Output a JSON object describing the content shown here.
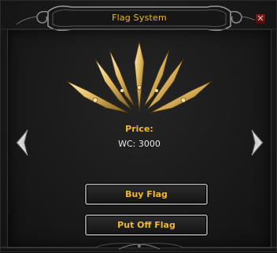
{
  "window": {
    "title": "Flag System",
    "close_symbol": "✕"
  },
  "flag": {
    "icon": "winged-flag-emblem-icon"
  },
  "price": {
    "label": "Price:",
    "value": "WC: 3000"
  },
  "navigation": {
    "left_icon": "chevron-left-icon",
    "right_icon": "chevron-right-icon"
  },
  "buttons": {
    "buy_label": "Buy Flag",
    "put_off_label": "Put Off Flag"
  },
  "colors": {
    "accent_gold": "#f0b830",
    "text_light": "#e8e8e8",
    "background": "#1a1a1a",
    "close_red": "#7a1f1f"
  }
}
